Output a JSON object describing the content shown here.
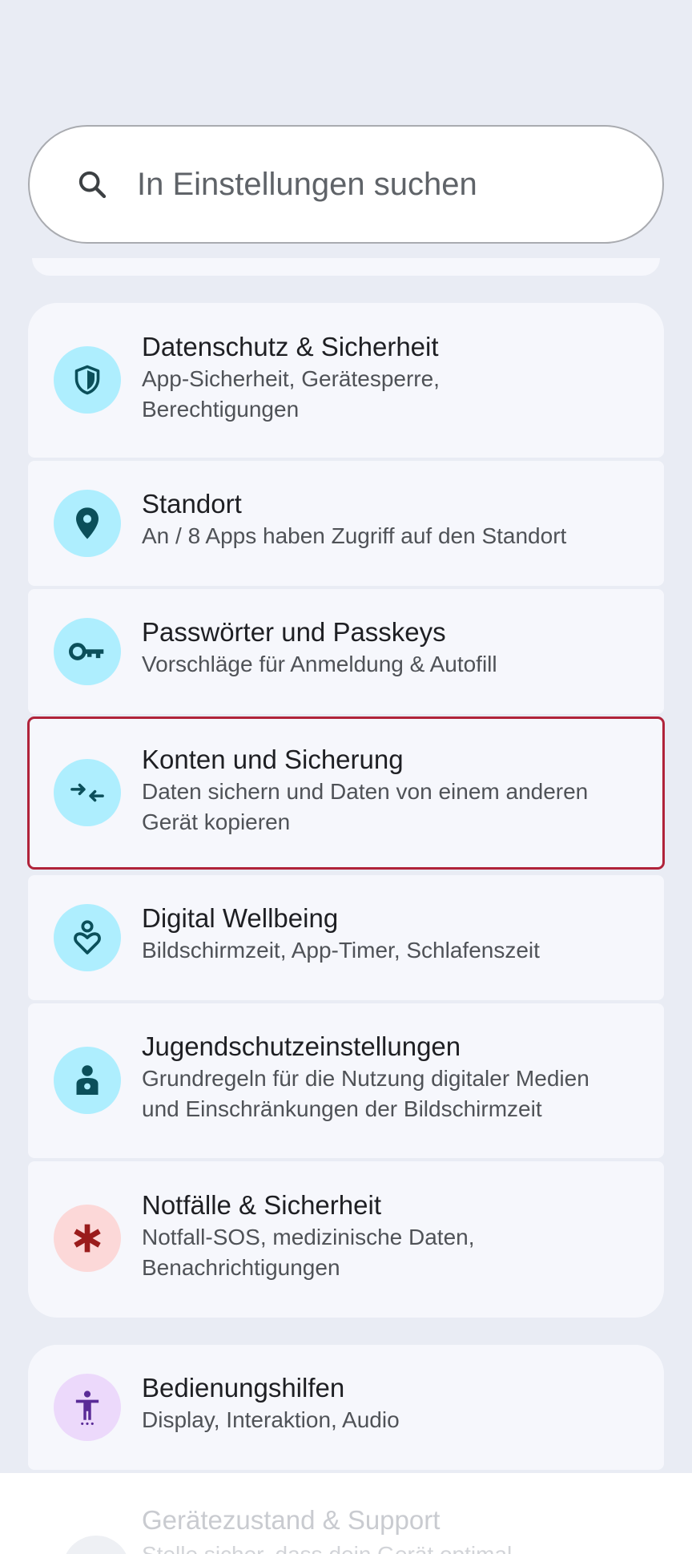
{
  "search": {
    "placeholder": "In Einstellungen suchen"
  },
  "groups": [
    {
      "items": [
        {
          "title": "Datenschutz & Sicherheit",
          "subtitle_line1": "App-Sicherheit, Gerätesperre,",
          "subtitle_line2": "Berechtigungen",
          "icon": "shield-icon"
        },
        {
          "title": "Standort",
          "subtitle_line1": "An / 8 Apps haben Zugriff auf den Standort",
          "icon": "location-pin-icon"
        },
        {
          "title": "Passwörter und Passkeys",
          "subtitle_line1": "Vorschläge für Anmeldung & Autofill",
          "icon": "key-icon"
        },
        {
          "title": "Konten und Sicherung",
          "subtitle_line1": "Daten sichern und Daten von einem anderen",
          "subtitle_line2": "Gerät kopieren",
          "icon": "sync-arrows-icon"
        },
        {
          "title": "Digital Wellbeing",
          "subtitle_line1": "Bildschirmzeit, App-Timer, Schlafenszeit",
          "icon": "wellbeing-heart-icon"
        },
        {
          "title": "Jugendschutzeinstellungen",
          "subtitle_line1": "Grundregeln für die Nutzung digitaler Medien",
          "subtitle_line2": "und Einschränkungen der Bildschirmzeit",
          "icon": "parental-controls-icon"
        },
        {
          "title": "Notfälle & Sicherheit",
          "subtitle_line1": "Notfall-SOS, medizinische Daten,",
          "subtitle_line2": "Benachrichtigungen",
          "icon": "emergency-asterisk-icon"
        }
      ]
    },
    {
      "items": [
        {
          "title": "Bedienungshilfen",
          "subtitle_line1": "Display, Interaktion, Audio",
          "icon": "accessibility-icon"
        }
      ]
    }
  ],
  "bottom": {
    "title": "Gerätezustand & Support",
    "subtitle": "Stelle sicher, dass dein Gerät optimal",
    "icon": "device-care-icon"
  },
  "colors": {
    "background": "#e9ecf4",
    "card": "#f6f7fc",
    "icon_cyan_bg": "#aeeefe",
    "icon_cyan_fg": "#0b4f5a",
    "icon_pink_bg": "#fcd8d8",
    "icon_pink_fg": "#9a1c1c",
    "icon_purple_bg": "#ecd9fb",
    "icon_purple_fg": "#5a2b97",
    "highlight": "#b0233a"
  }
}
